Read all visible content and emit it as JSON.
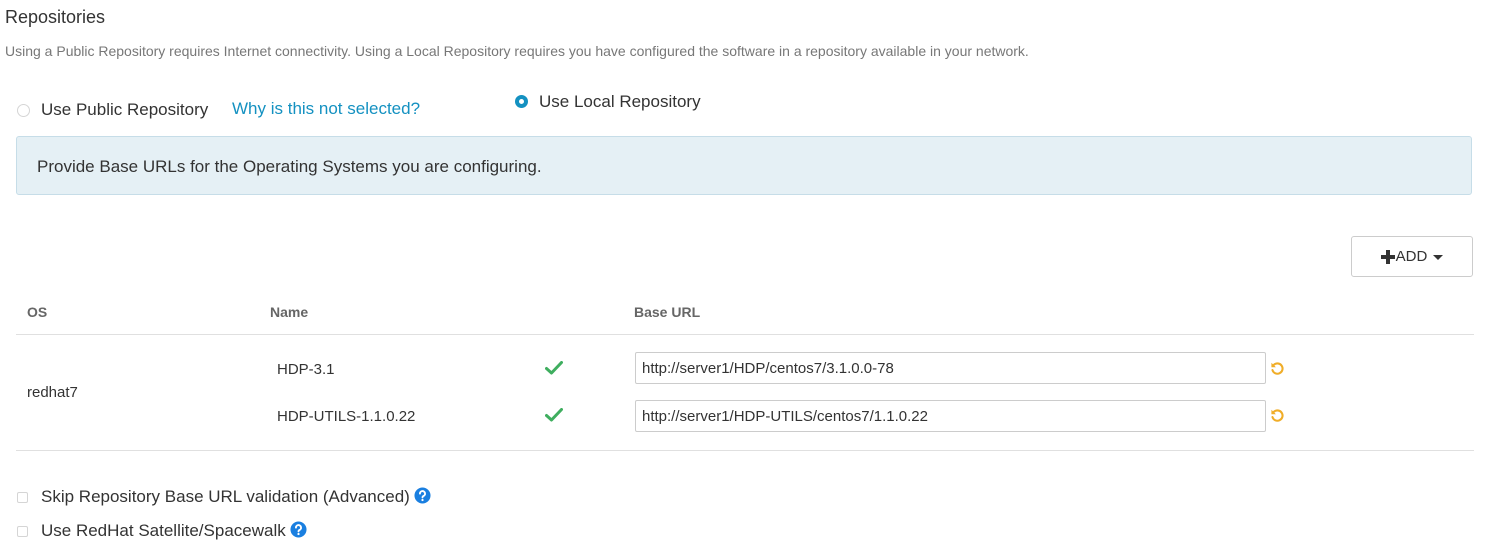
{
  "section": {
    "title": "Repositories",
    "description": "Using a Public Repository requires Internet connectivity. Using a Local Repository requires you have configured the software in a repository available in your network."
  },
  "repo_choice": {
    "public_label": "Use Public Repository",
    "public_selected": false,
    "why_link": "Why is this not selected?",
    "local_label": "Use Local Repository",
    "local_selected": true
  },
  "info_box": {
    "text": "Provide Base URLs for the Operating Systems you are configuring."
  },
  "add_button": {
    "label": "ADD",
    "icons": [
      "plus-icon",
      "caret-down-icon"
    ]
  },
  "table": {
    "headers": {
      "os": "OS",
      "name": "Name",
      "base_url": "Base URL"
    },
    "os": "redhat7",
    "rows": [
      {
        "name": "HDP-3.1",
        "status_icon": "check-icon",
        "base_url": "http://server1/HDP/centos7/3.1.0.0-78",
        "action_icon": "undo-icon"
      },
      {
        "name": "HDP-UTILS-1.1.0.22",
        "status_icon": "check-icon",
        "base_url": "http://server1/HDP-UTILS/centos7/1.1.0.22",
        "action_icon": "undo-icon"
      }
    ]
  },
  "options": {
    "skip_validation_label": "Skip Repository Base URL validation (Advanced)",
    "skip_validation_checked": false,
    "satellite_label": "Use RedHat Satellite/Spacewalk",
    "satellite_checked": false
  },
  "colors": {
    "accent": "#1491c1",
    "success": "#3fae5f",
    "warning": "#f0ad28",
    "help": "#1a7fe0",
    "info_bg": "#e5f0f5"
  }
}
